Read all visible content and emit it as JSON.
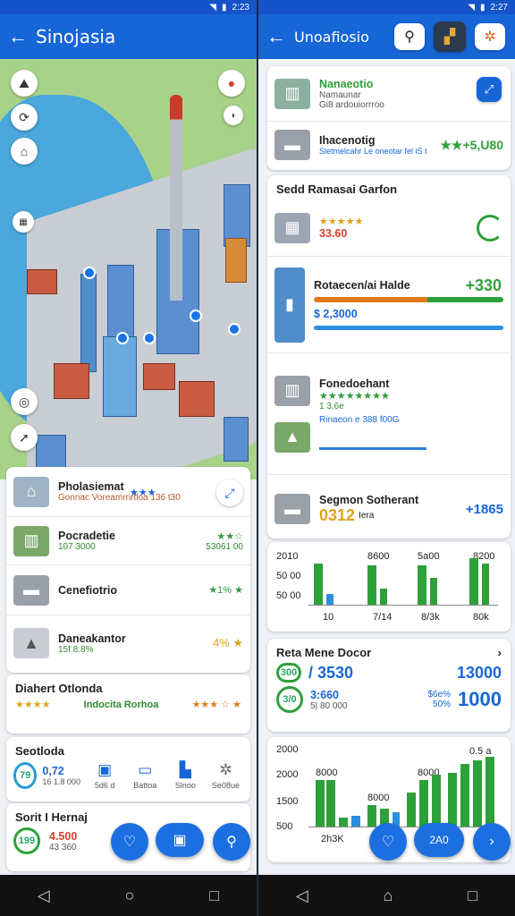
{
  "left": {
    "status_time": "2:23",
    "title": "Sinojasia",
    "cards": [
      {
        "title": "Pholasiemat",
        "sub": "Gonnac Voreamrnrtloa 136 t30",
        "stars": "★★★"
      },
      {
        "title": "Pocradetie",
        "sub": "107 3000",
        "rating": "★★☆",
        "extra": "53061 00"
      },
      {
        "title": "Cenefiotrio",
        "sub": "",
        "rating": "★1% ★"
      },
      {
        "title": "Daneakantor",
        "sub": "15f 8.8%",
        "rating": "4% ★"
      }
    ],
    "section1": {
      "title": "Diahert Otlonda",
      "sub": "Indocita Rorhoa",
      "stars": "★★★ ☆ ★"
    },
    "section2": {
      "title": "Seotloda",
      "ring": "79",
      "value": "0,72",
      "value_sub": "16 1.8 000",
      "icons": [
        {
          "label": "5d6 d"
        },
        {
          "label": "Battoa"
        },
        {
          "label": "Slnoo"
        },
        {
          "label": "Se08ue"
        }
      ]
    },
    "section3": {
      "title": "Sorit I Hernaj",
      "ring": "199",
      "value": "4.500",
      "sub": "43 360"
    }
  },
  "right": {
    "status_time": "2:27",
    "title": "Unoafiosio",
    "top_rows": [
      {
        "title": "Nanaeotio",
        "sub1": "Namaunar",
        "sub2": "Gi8 ardouiorrroo"
      },
      {
        "title": "Ihacenotig",
        "sub1": "Sletmelcahr Le oneotar fel iS t",
        "value": "★★+5,U80"
      }
    ],
    "section1": {
      "title": "Sedd Ramasai Garfon",
      "rows": [
        {
          "value": "33.60",
          "stars": "★★★★★"
        },
        {
          "title": "Rotaecen/ai Halde",
          "value": "+330",
          "sub": "$ 2,3000"
        },
        {
          "title": "Fonedoehant",
          "sub": "1 3.6e",
          "sub2": "Rinaeon e 388 f00G"
        },
        {
          "title": "Segmon Sotherant",
          "value": "0312",
          "value_label": "Iera",
          "right": "+1865"
        }
      ]
    },
    "chart1": {
      "ylabels": [
        "2010",
        "50 00",
        "50 00"
      ],
      "xlabels": [
        "10",
        "7/14",
        "8/3k",
        "80k"
      ],
      "top_labels": [
        "8600",
        "5a00",
        "8200"
      ]
    },
    "section2": {
      "title": "Reta Mene Docor",
      "row1": {
        "ring": "300",
        "value": "/ 3530",
        "right": "13000"
      },
      "row2": {
        "ring": "3/0",
        "value": "3:660",
        "value_sub": "5| 80 000",
        "right": "1000",
        "right_pct": "$6e%",
        "right_sub": "50%"
      }
    },
    "chart2": {
      "ylabels": [
        "2000",
        "2000",
        "1500",
        "500"
      ],
      "top_labels": [
        "8000",
        "8000",
        "8000",
        "0.5 a"
      ],
      "xlabel": "2h3K"
    },
    "fab_label": "2A0"
  },
  "colors": {
    "primary": "#1766d8",
    "green": "#2ea03a",
    "orange": "#e07a1a"
  }
}
